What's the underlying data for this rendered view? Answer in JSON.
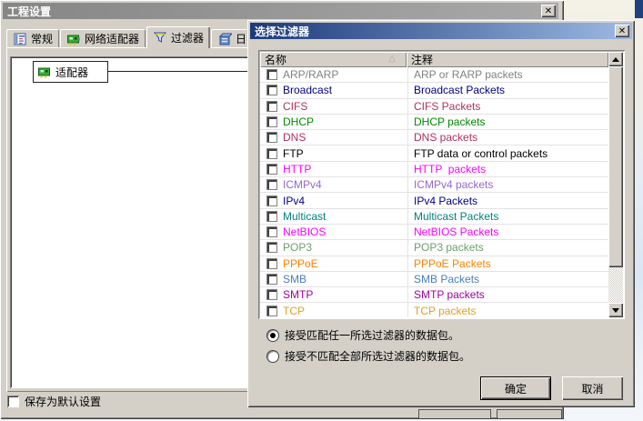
{
  "icons": {
    "close": "✕",
    "sort": "△"
  },
  "colors": {
    "face": "#d4d0c8",
    "title-a1": "#1c3a7a",
    "title-a2": "#9db9e2",
    "title-i1": "#868686",
    "title-i2": "#a9a9a9"
  },
  "main_dialog": {
    "title": "工程设置",
    "tabs": [
      {
        "label": "常规",
        "active": false
      },
      {
        "label": "网络适配器",
        "active": false
      },
      {
        "label": "过滤器",
        "active": true
      },
      {
        "label": "日",
        "active": false
      }
    ],
    "canvas": {
      "node_label": "适配器"
    },
    "save_default": {
      "label": "保存为默认设置",
      "checked": false
    }
  },
  "filter_dialog": {
    "title": "选择过滤器",
    "list": {
      "columns": {
        "name": "名称",
        "comment": "注释"
      },
      "partial_row": true,
      "rows": [
        {
          "name": "ARP/RARP",
          "comment": "ARP or RARP packets",
          "color": "#808080",
          "checked": false
        },
        {
          "name": "Broadcast",
          "comment": "Broadcast Packets",
          "color": "#000080",
          "checked": false
        },
        {
          "name": "CIFS",
          "comment": "CIFS Packets",
          "color": "#b03060",
          "checked": false
        },
        {
          "name": "DHCP",
          "comment": "DHCP packets",
          "color": "#008800",
          "checked": false
        },
        {
          "name": "DNS",
          "comment": "DNS packets",
          "color": "#b03060",
          "checked": false
        },
        {
          "name": "FTP",
          "comment": "FTP data or control packets",
          "color": "#000000",
          "checked": false
        },
        {
          "name": "HTTP",
          "comment": "HTTP  packets",
          "color": "#ff00ff",
          "checked": false
        },
        {
          "name": "ICMPv4",
          "comment": "ICMPv4 packets",
          "color": "#9966cc",
          "checked": false
        },
        {
          "name": "IPv4",
          "comment": "IPv4 Packets",
          "color": "#000080",
          "checked": false
        },
        {
          "name": "Multicast",
          "comment": "Multicast Packets",
          "color": "#008080",
          "checked": false
        },
        {
          "name": "NetBIOS",
          "comment": "NetBIOS Packets",
          "color": "#ff00ff",
          "checked": false
        },
        {
          "name": "POP3",
          "comment": "POP3 packets",
          "color": "#6b9e6b",
          "checked": false
        },
        {
          "name": "PPPoE",
          "comment": "PPPoE Packets",
          "color": "#ff8000",
          "checked": false
        },
        {
          "name": "SMB",
          "comment": "SMB Packets",
          "color": "#4a7eb8",
          "checked": false
        },
        {
          "name": "SMTP",
          "comment": "SMTP packets",
          "color": "#a000a0",
          "checked": false
        },
        {
          "name": "TCP",
          "comment": "TCP packets",
          "color": "#e0a028",
          "checked": false
        }
      ]
    },
    "radios": [
      {
        "label": "接受匹配任一所选过滤器的数据包。",
        "selected": true
      },
      {
        "label": "接受不匹配全部所选过滤器的数据包。",
        "selected": false
      }
    ],
    "ok_label": "确定",
    "cancel_label": "取消"
  }
}
